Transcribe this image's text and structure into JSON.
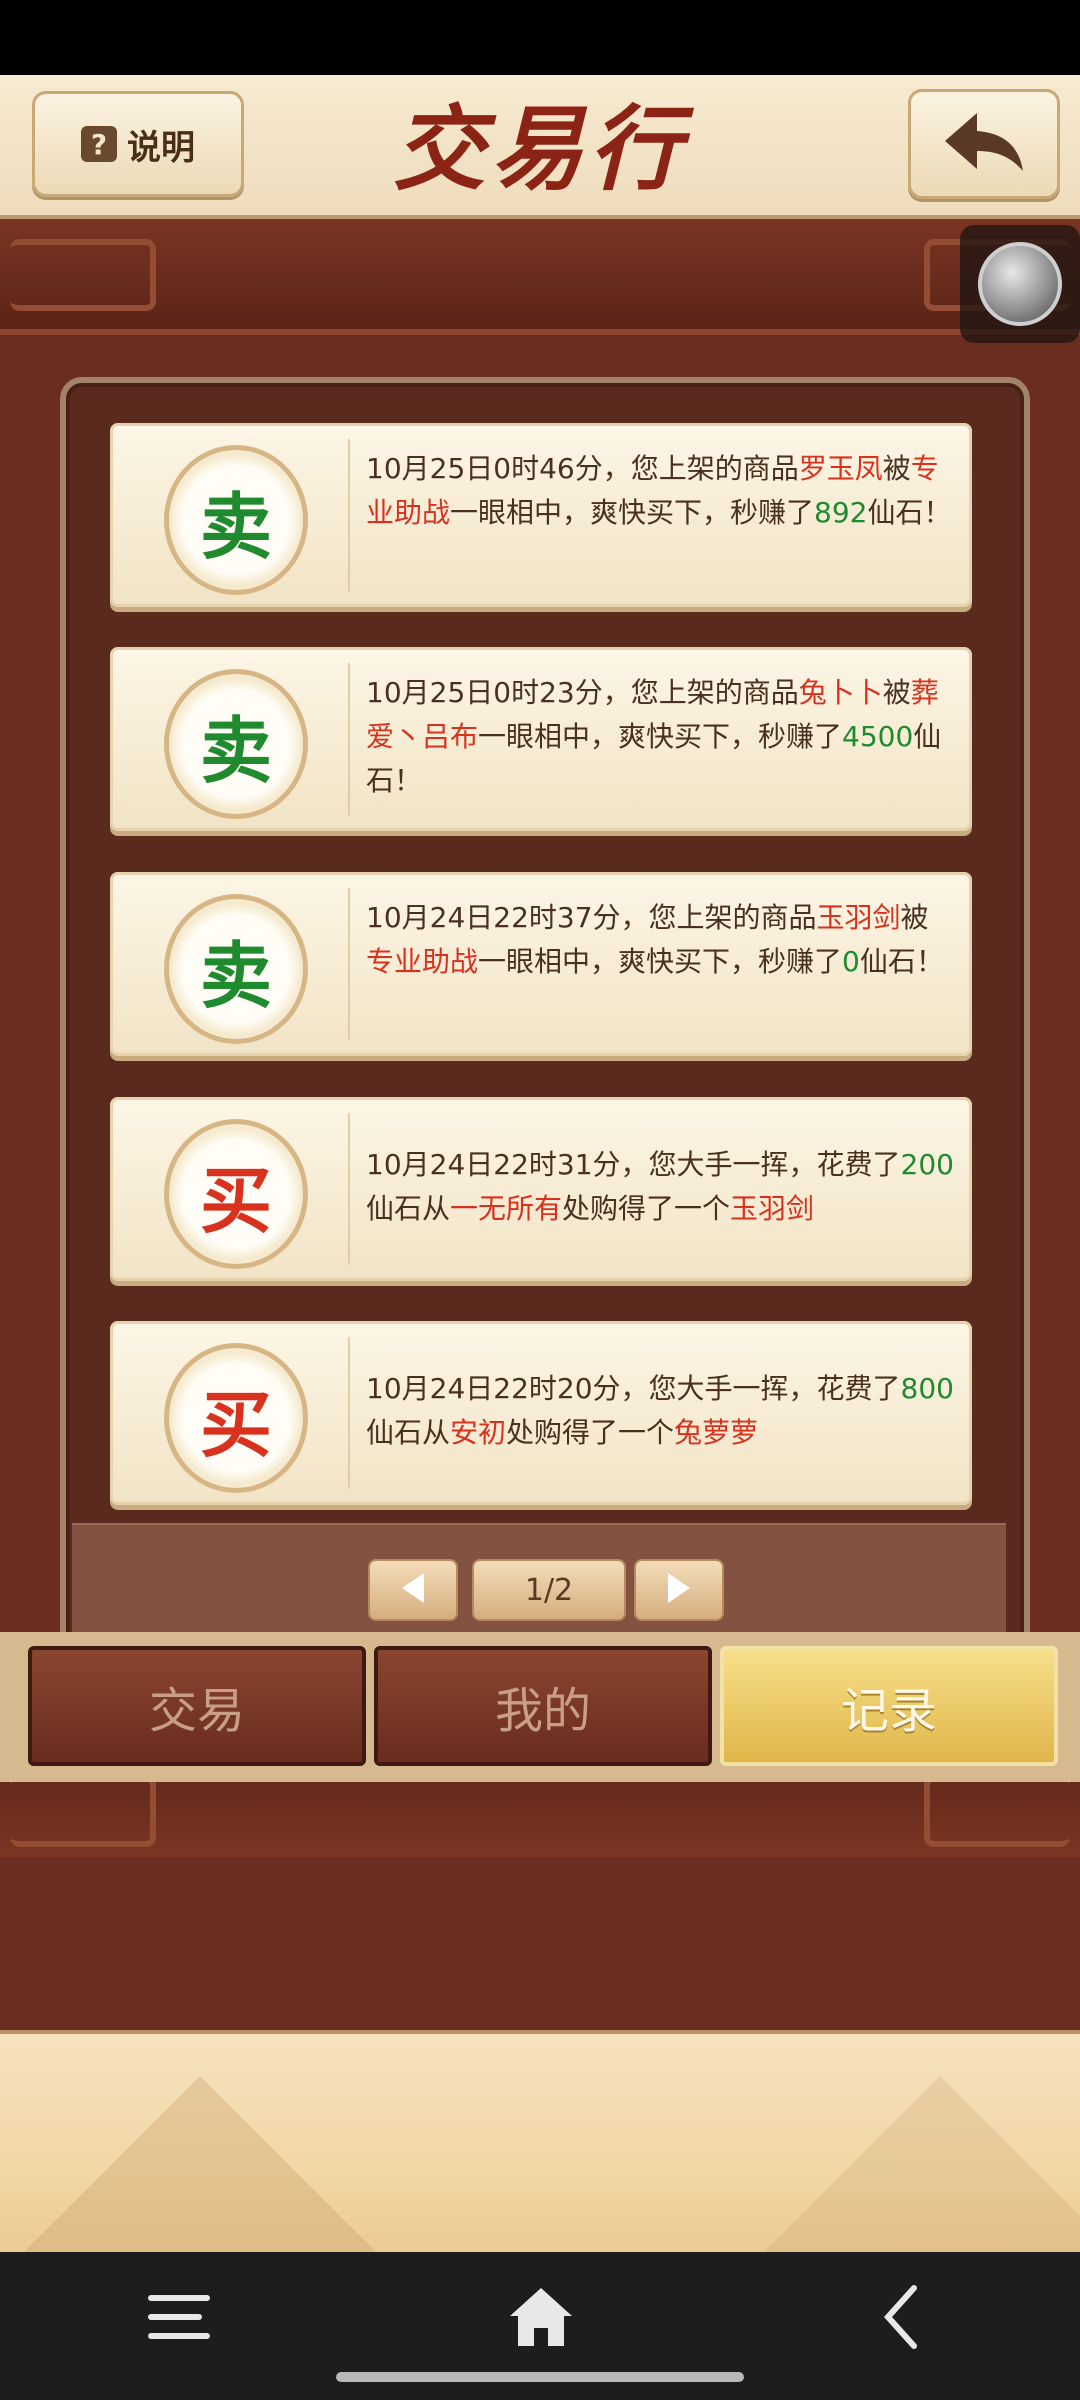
{
  "header": {
    "help_icon": "?",
    "help_label": "说明",
    "title": "交易行",
    "back_icon": "back-arrow-icon"
  },
  "records": [
    {
      "type": "sell",
      "seal": "卖",
      "segments": [
        {
          "text": "10月25日0时46分，您上架的商品",
          "color": "normal"
        },
        {
          "text": "罗玉凤",
          "color": "red"
        },
        {
          "text": "被",
          "color": "normal"
        },
        {
          "text": "专业助战",
          "color": "red"
        },
        {
          "text": "一眼相中，爽快买下，秒赚了",
          "color": "normal"
        },
        {
          "text": "892",
          "color": "green"
        },
        {
          "text": "仙石！",
          "color": "normal"
        }
      ]
    },
    {
      "type": "sell",
      "seal": "卖",
      "segments": [
        {
          "text": "10月25日0时23分，您上架的商品",
          "color": "normal"
        },
        {
          "text": "兔卜卜",
          "color": "red"
        },
        {
          "text": "被",
          "color": "normal"
        },
        {
          "text": "葬爱丶吕布",
          "color": "red"
        },
        {
          "text": "一眼相中，爽快买下，秒赚了",
          "color": "normal"
        },
        {
          "text": "4500",
          "color": "green"
        },
        {
          "text": "仙石！",
          "color": "normal"
        }
      ]
    },
    {
      "type": "sell",
      "seal": "卖",
      "segments": [
        {
          "text": "10月24日22时37分，您上架的商品",
          "color": "normal"
        },
        {
          "text": "玉羽剑",
          "color": "red"
        },
        {
          "text": "被",
          "color": "normal"
        },
        {
          "text": "专业助战",
          "color": "red"
        },
        {
          "text": "一眼相中，爽快买下，秒赚了",
          "color": "normal"
        },
        {
          "text": "0",
          "color": "green"
        },
        {
          "text": "仙石！",
          "color": "normal"
        }
      ]
    },
    {
      "type": "buy",
      "seal": "买",
      "segments": [
        {
          "text": "10月24日22时31分，您大手一挥，花费了",
          "color": "normal"
        },
        {
          "text": "200",
          "color": "green"
        },
        {
          "text": "仙石从",
          "color": "normal"
        },
        {
          "text": "一无所有",
          "color": "red"
        },
        {
          "text": "处购得了一个",
          "color": "normal"
        },
        {
          "text": "玉羽剑",
          "color": "red"
        }
      ]
    },
    {
      "type": "buy",
      "seal": "买",
      "segments": [
        {
          "text": "10月24日22时20分，您大手一挥，花费了",
          "color": "normal"
        },
        {
          "text": "800",
          "color": "green"
        },
        {
          "text": "仙石从",
          "color": "normal"
        },
        {
          "text": "安初",
          "color": "red"
        },
        {
          "text": "处购得了一个",
          "color": "normal"
        },
        {
          "text": "兔萝萝",
          "color": "red"
        }
      ]
    }
  ],
  "pager": {
    "page_label": "1/2",
    "prev_icon": "triangle-left-icon",
    "next_icon": "triangle-right-icon"
  },
  "tabs": [
    {
      "label": "交易",
      "active": false
    },
    {
      "label": "我的",
      "active": false
    },
    {
      "label": "记录",
      "active": true
    }
  ],
  "colors": {
    "red": "#d8321f",
    "green": "#1f8a2e",
    "brown_bg": "#6b2d1f",
    "active_tab": "#e0b64a"
  },
  "nav": {
    "menu_icon": "hamburger-menu-icon",
    "home_icon": "home-icon",
    "back_icon": "chevron-left-icon"
  }
}
